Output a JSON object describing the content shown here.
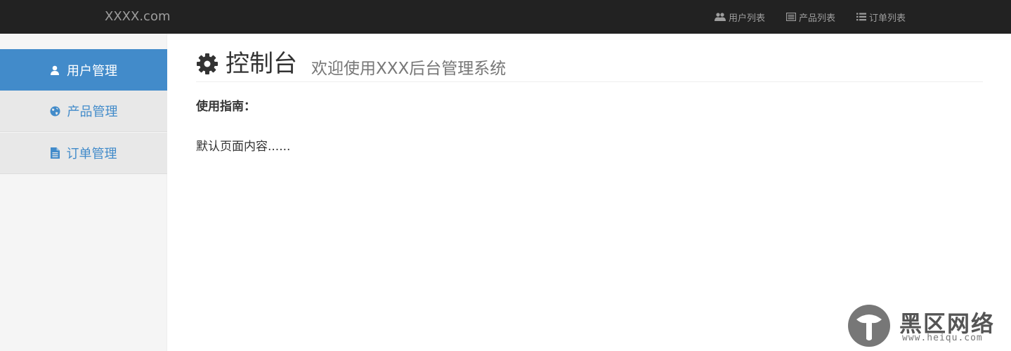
{
  "navbar": {
    "brand": "XXXX.com",
    "links": [
      {
        "label": "用户列表",
        "icon": "users-icon"
      },
      {
        "label": "产品列表",
        "icon": "list-alt-icon"
      },
      {
        "label": "订单列表",
        "icon": "list-icon"
      }
    ]
  },
  "sidebar": {
    "items": [
      {
        "label": "用户管理",
        "icon": "user-icon",
        "active": true
      },
      {
        "label": "产品管理",
        "icon": "globe-icon",
        "active": false
      },
      {
        "label": "订单管理",
        "icon": "file-icon",
        "active": false
      }
    ]
  },
  "main": {
    "title": "控制台",
    "title_icon": "gear-icon",
    "subtitle": "欢迎使用XXX后台管理系统",
    "guide_title": "使用指南：",
    "body_text": "默认页面内容......"
  },
  "watermark": {
    "logo_text": "黑区网络",
    "url": "www.heiqu.com"
  },
  "colors": {
    "navbar_bg": "#222222",
    "navbar_text": "#9d9d9d",
    "accent": "#428bca",
    "sidebar_bg": "#f5f5f5"
  }
}
